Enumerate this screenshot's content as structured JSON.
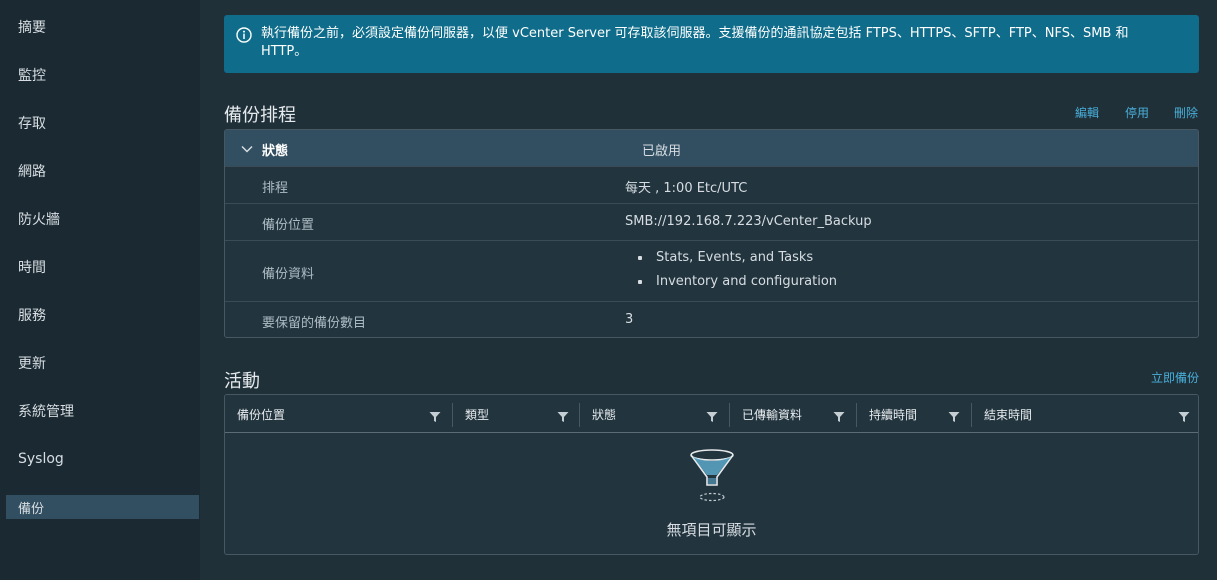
{
  "sidebar": {
    "items": [
      {
        "label": "摘要"
      },
      {
        "label": "監控"
      },
      {
        "label": "存取"
      },
      {
        "label": "網路"
      },
      {
        "label": "防火牆"
      },
      {
        "label": "時間"
      },
      {
        "label": "服務"
      },
      {
        "label": "更新"
      },
      {
        "label": "系統管理"
      },
      {
        "label": "Syslog"
      },
      {
        "label": "備份"
      }
    ],
    "active_index": 10
  },
  "banner": {
    "icon": "info-icon",
    "text": "執行備份之前，必須設定備份伺服器，以便 vCenter Server 可存取該伺服器。支援備份的通訊協定包括 FTPS、HTTPS、SFTP、FTP、NFS、SMB 和 HTTP。"
  },
  "schedule": {
    "title": "備份排程",
    "actions": {
      "edit": "編輯",
      "disable": "停用",
      "delete": "刪除"
    },
    "status_label": "狀態",
    "status_value": "已啟用",
    "rows": {
      "schedule": {
        "label": "排程",
        "value": "每天 , 1:00 Etc/UTC"
      },
      "location": {
        "label": "備份位置",
        "value": "SMB://192.168.7.223/vCenter_Backup"
      },
      "data": {
        "label": "備份資料",
        "items": [
          "Stats, Events, and Tasks",
          "Inventory and configuration"
        ]
      },
      "retain": {
        "label": "要保留的備份數目",
        "value": "3"
      }
    }
  },
  "activity": {
    "title": "活動",
    "backup_now": "立即備份",
    "columns": [
      "備份位置",
      "類型",
      "狀態",
      "已傳輸資料",
      "持續時間",
      "結束時間"
    ],
    "empty_text": "無項目可顯示",
    "empty_icon": "funnel-icon"
  },
  "colors": {
    "accent_link": "#49afd9",
    "banner_bg": "#0f6d8b",
    "active_nav": "#324f61"
  }
}
